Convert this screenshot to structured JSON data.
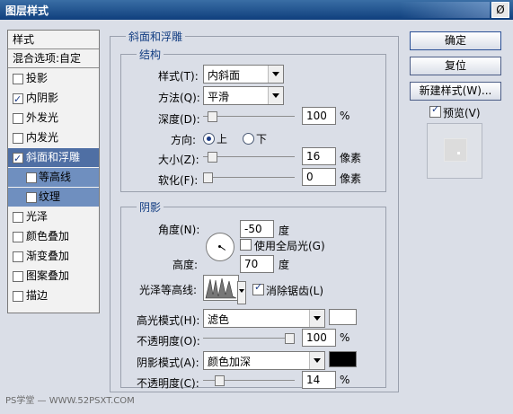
{
  "window": {
    "title": "图层样式",
    "close_label": "Ø"
  },
  "sidebar": {
    "items": [
      {
        "label": "样式"
      },
      {
        "label": "混合选项:自定"
      },
      {
        "label": "投影",
        "checked": false
      },
      {
        "label": "内阴影",
        "checked": true
      },
      {
        "label": "外发光",
        "checked": false
      },
      {
        "label": "内发光",
        "checked": false
      },
      {
        "label": "斜面和浮雕",
        "checked": true,
        "selected": true
      },
      {
        "label": "等高线",
        "checked": false,
        "sub": true
      },
      {
        "label": "纹理",
        "checked": false,
        "sub": true
      },
      {
        "label": "光泽",
        "checked": false
      },
      {
        "label": "颜色叠加",
        "checked": false
      },
      {
        "label": "渐变叠加",
        "checked": false
      },
      {
        "label": "图案叠加",
        "checked": false
      },
      {
        "label": "描边",
        "checked": false
      }
    ]
  },
  "bevel": {
    "section_title": "斜面和浮雕",
    "structure_title": "结构",
    "style_label": "样式(T):",
    "style_value": "内斜面",
    "technique_label": "方法(Q):",
    "technique_value": "平滑",
    "depth_label": "深度(D):",
    "depth_value": "100",
    "depth_unit": "%",
    "direction_label": "方向:",
    "dir_up": "上",
    "dir_down": "下",
    "size_label": "大小(Z):",
    "size_value": "16",
    "size_unit": "像素",
    "soften_label": "软化(F):",
    "soften_value": "0",
    "soften_unit": "像素"
  },
  "shading": {
    "title": "阴影",
    "angle_label": "角度(N):",
    "angle_value": "-50",
    "angle_unit": "度",
    "global_light_label": "使用全局光(G)",
    "altitude_label": "高度:",
    "altitude_value": "70",
    "altitude_unit": "度",
    "gloss_label": "光泽等高线:",
    "antialias_label": "消除锯齿(L)",
    "highlight_label": "高光模式(H):",
    "highlight_mode": "滤色",
    "highlight_color": "#ffffff",
    "opacity1_label": "不透明度(O):",
    "opacity1_value": "100",
    "opacity1_unit": "%",
    "shadow_label": "阴影模式(A):",
    "shadow_mode": "颜色加深",
    "shadow_color": "#000000",
    "opacity2_label": "不透明度(C):",
    "opacity2_value": "14",
    "opacity2_unit": "%"
  },
  "buttons": {
    "ok": "确定",
    "reset": "复位",
    "new_style": "新建样式(W)...",
    "preview": "预览(V)"
  },
  "watermark": "PS学堂 — WWW.52PSXT.COM",
  "sliders": {
    "depth": 0.05,
    "size": 0.05,
    "soften": 0.0,
    "opacity1": 1.0,
    "opacity2": 0.14
  }
}
